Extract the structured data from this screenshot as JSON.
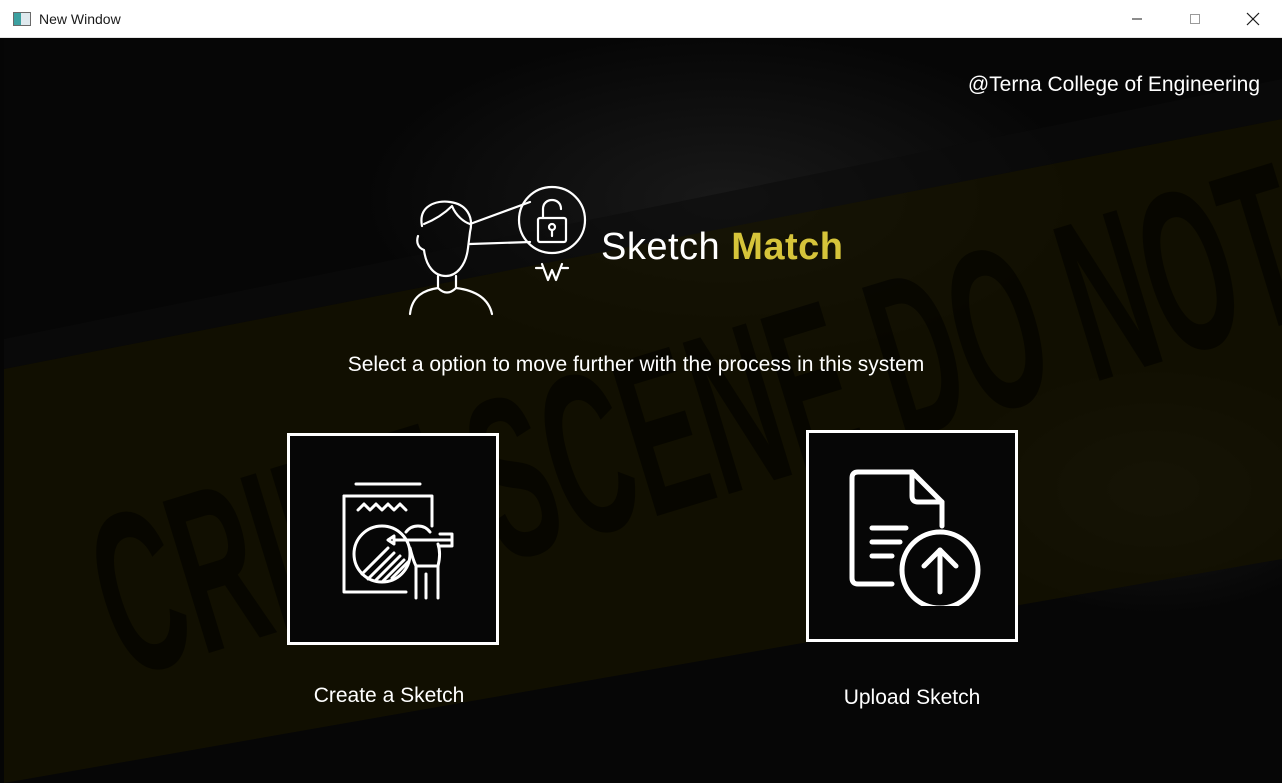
{
  "window": {
    "title": "New Window",
    "controls": {
      "minimize_icon": "minimize-icon",
      "maximize_icon": "maximize-icon",
      "close_icon": "close-icon"
    }
  },
  "header": {
    "credit": "@Terna College of Engineering"
  },
  "brand": {
    "name_part1": "Sketch",
    "name_part2": "Match",
    "accent_color": "#d6c43a",
    "logo_icon": "face-lock-icon"
  },
  "main": {
    "prompt": "Select a option to move further with the process in this system",
    "options": [
      {
        "label": "Create a Sketch",
        "icon": "sketch-drawing-icon"
      },
      {
        "label": "Upload Sketch",
        "icon": "upload-document-icon"
      }
    ]
  },
  "background": {
    "watermark": "CRIME SCENE DO NOT"
  }
}
